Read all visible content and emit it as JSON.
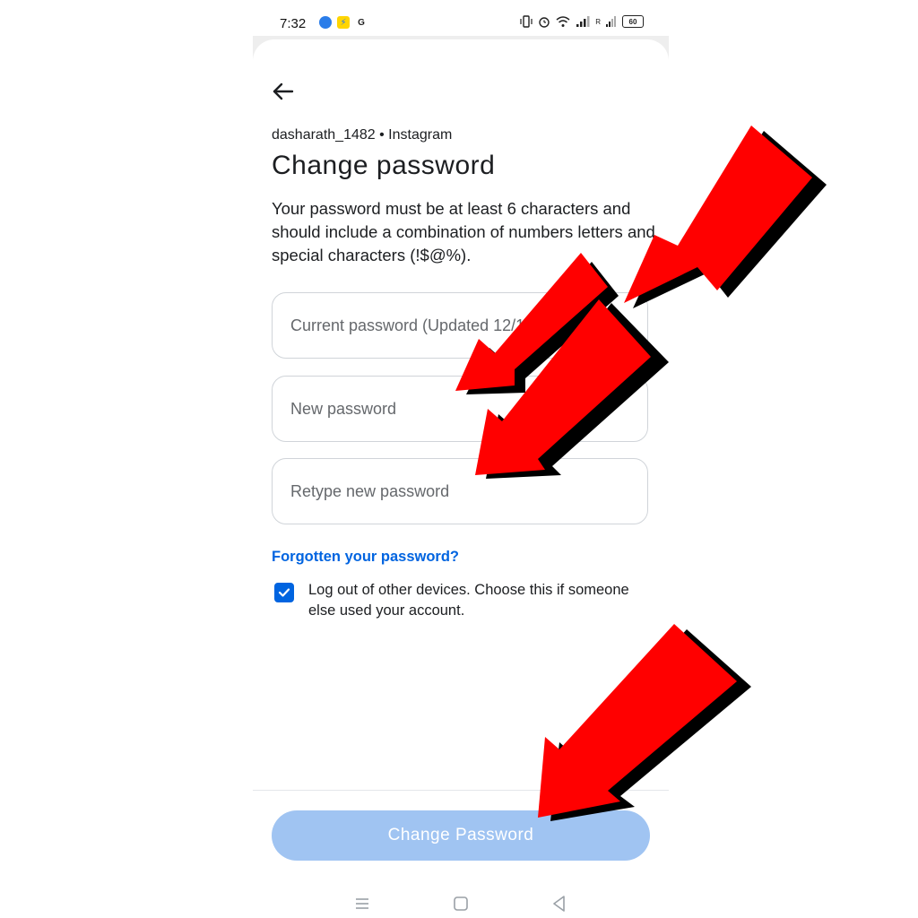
{
  "status_bar": {
    "time": "7:32",
    "app_icons": [
      "browser-icon",
      "flipkart-icon",
      "google-icon"
    ],
    "google_letter": "G",
    "battery_level": "60",
    "signal_label": "R"
  },
  "header": {
    "account_line": "dasharath_1482 • Instagram",
    "title": "Change password",
    "description": "Your password must be at least 6 characters and should include a combination of numbers letters and special characters (!$@%)."
  },
  "form": {
    "current_password_placeholder": "Current password (Updated 12/12/2023)",
    "new_password_placeholder": "New password",
    "retype_password_placeholder": "Retype new password",
    "forgot_link": "Forgotten your password?",
    "logout_checkbox_label": "Log out of other devices. Choose this if someone else used your account.",
    "logout_checked": true
  },
  "footer": {
    "submit_label": "Change Password"
  },
  "colors": {
    "accent": "#0064e0",
    "button_disabled": "#a0c4f2",
    "annotation_arrow": "#ff0000"
  }
}
